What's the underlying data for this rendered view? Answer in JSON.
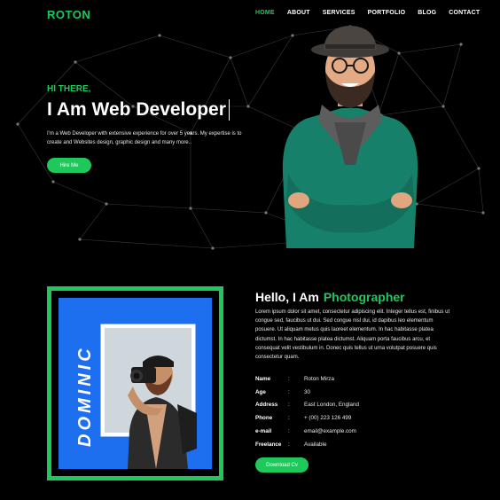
{
  "brand": {
    "logo": "ROTON",
    "accent": "#1ec85a",
    "background": "#000000",
    "photo_bg": "#1e6ff0"
  },
  "nav": {
    "items": [
      "HOME",
      "ABOUT",
      "SERVICES",
      "PORTFOLIO",
      "BLOG",
      "CONTACT"
    ],
    "active": "HOME"
  },
  "hero": {
    "kicker": "HI THERE,",
    "title": "I Am Web Developer",
    "description": "I'm a Web Developer with extensive experience for over 5 years. My expertise is to create and Websites design, graphic design and many more..",
    "button": "Hire Me"
  },
  "about": {
    "heading_prefix": "Hello, I Am",
    "heading_accent": "Photographer",
    "photo_caption": "DOMINIC",
    "text": "Lorem ipsum dolor sit amet, consectetur adipiscing elit. Integer tellus est, finibus ut congue sed, faucibus ut dui. Sed congue nisl dui, id dapibus leo elementum posuere. Ut aliquam metus quis laoreet elementum. In hac habitasse platea dictumst. In hac habitasse platea dictumst. Aliquam porta faucibus arcu, et consequat velit vestibulum in. Donec quis tellus ut urna volutpat posuere quis consectetur quam.",
    "info": [
      {
        "label": "Name",
        "value": "Roton Mirza"
      },
      {
        "label": "Age",
        "value": "30"
      },
      {
        "label": "Address",
        "value": "East London, England"
      },
      {
        "label": "Phone",
        "value": "+ (00) 223 126 499"
      },
      {
        "label": "e-mail",
        "value": "email@example.com"
      },
      {
        "label": "Freelance",
        "value": "Available"
      }
    ],
    "colon": ":",
    "button": "Download Cv"
  }
}
